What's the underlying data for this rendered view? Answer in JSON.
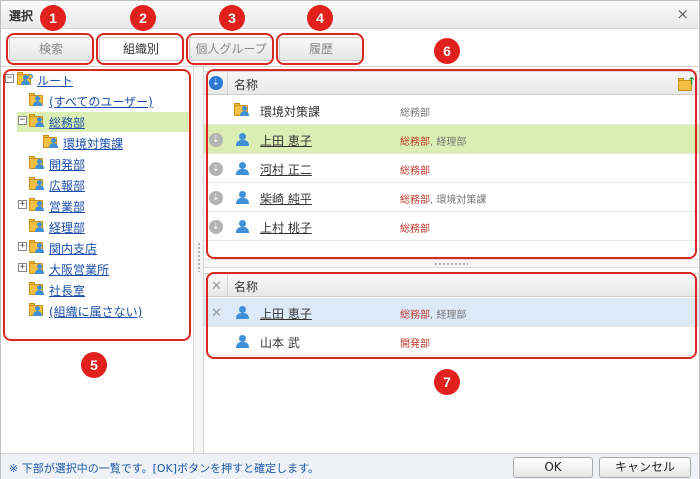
{
  "window": {
    "title": "選択",
    "close_glyph": "×"
  },
  "tabs": [
    {
      "label": "検索",
      "active": false
    },
    {
      "label": "組織別",
      "active": true
    },
    {
      "label": "個人グループ",
      "active": false
    },
    {
      "label": "履歴",
      "active": false
    }
  ],
  "markers": [
    "1",
    "2",
    "3",
    "4",
    "5",
    "6",
    "7"
  ],
  "tree": {
    "expander_collapsed": "+",
    "expander_expanded": "−",
    "nodes": [
      {
        "label": "ルート",
        "icon": "folder-users-icon",
        "expander": "−",
        "selected": false
      },
      {
        "label": "(すべてのユーザー)",
        "icon": "folder-users-icon",
        "expander": "",
        "selected": false
      },
      {
        "label": "総務部",
        "icon": "folder-user-icon",
        "expander": "−",
        "selected": true
      },
      {
        "label": "環境対策課",
        "icon": "folder-user-icon",
        "expander": "",
        "selected": false
      },
      {
        "label": "開発部",
        "icon": "folder-user-icon",
        "expander": "",
        "selected": false
      },
      {
        "label": "広報部",
        "icon": "folder-user-icon",
        "expander": "",
        "selected": false
      },
      {
        "label": "営業部",
        "icon": "folder-user-icon",
        "expander": "+",
        "selected": false
      },
      {
        "label": "経理部",
        "icon": "folder-user-icon",
        "expander": "",
        "selected": false
      },
      {
        "label": "関内支店",
        "icon": "folder-user-icon",
        "expander": "+",
        "selected": false
      },
      {
        "label": "大阪営業所",
        "icon": "folder-user-icon",
        "expander": "+",
        "selected": false
      },
      {
        "label": "社長室",
        "icon": "folder-user-icon",
        "expander": "",
        "selected": false
      },
      {
        "label": "(組織に属さない)",
        "icon": "folder-users-icon",
        "expander": "",
        "selected": false
      }
    ]
  },
  "candidates": {
    "header_name": "名称",
    "header_icon": "add-all-icon",
    "column_icon": "expand-circle-icon",
    "rows": [
      {
        "name": "環境対策課",
        "type": "group",
        "dept": "総務部",
        "dept_extra": "",
        "selected": false
      },
      {
        "name": "上田 恵子",
        "type": "user",
        "dept": "総務部",
        "dept_extra": ", 経理部",
        "selected": true
      },
      {
        "name": "河村 正二",
        "type": "user",
        "dept": "総務部",
        "dept_extra": "",
        "selected": false
      },
      {
        "name": "柴崎 純平",
        "type": "user",
        "dept": "総務部",
        "dept_extra": ", 環境対策課",
        "selected": false
      },
      {
        "name": "上村 桃子",
        "type": "user",
        "dept": "総務部",
        "dept_extra": "",
        "selected": false
      }
    ]
  },
  "selected_list": {
    "header_name": "名称",
    "header_icon": "remove-all-icon",
    "rows": [
      {
        "name": "上田 恵子",
        "dept": "総務部",
        "dept_extra": ", 経理部",
        "removable": true,
        "selected": true
      },
      {
        "name": "山本 武",
        "dept": "開発部",
        "dept_extra": "",
        "removable": false,
        "selected": false
      }
    ]
  },
  "footer": {
    "note": "※ 下部が選択中の一覧です。[OK]ボタンを押すと確定します。",
    "ok_label": "OK",
    "cancel_label": "キャンセル"
  },
  "colors": {
    "marker_red": "#e0211c",
    "selected_green": "#dbefb4",
    "selected_blue": "#dce9f7",
    "link_blue": "#1b4fa8",
    "dept_red": "#c0392b"
  }
}
